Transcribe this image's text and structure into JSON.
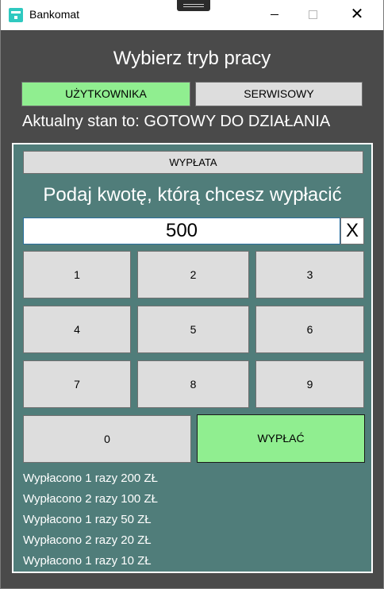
{
  "window": {
    "title": "Bankomat",
    "close_glyph": "✕"
  },
  "heading": "Wybierz tryb pracy",
  "modes": {
    "user_label": "UŻYTKOWNIKA",
    "service_label": "SERWISOWY",
    "active": "user",
    "active_color": "#90ee90"
  },
  "status": {
    "text": "Aktualny stan to: GOTOWY DO DZIAŁANIA"
  },
  "panel": {
    "mode_button_label": "WYPŁATA",
    "prompt": "Podaj kwotę, którą chcesz wypłacić",
    "amount_value": "500",
    "clear_label": "X",
    "keys": [
      "1",
      "2",
      "3",
      "4",
      "5",
      "6",
      "7",
      "8",
      "9",
      "0"
    ],
    "withdraw_label": "WYPŁAĆ",
    "withdraw_color": "#90ee90",
    "log": [
      "Wypłacono 1 razy 200 ZŁ",
      "Wypłacono 2 razy 100 ZŁ",
      "Wypłacono 1 razy 50 ZŁ",
      "Wypłacono 2 razy 20 ZŁ",
      "Wypłacono 1 razy 10 ZŁ"
    ]
  }
}
